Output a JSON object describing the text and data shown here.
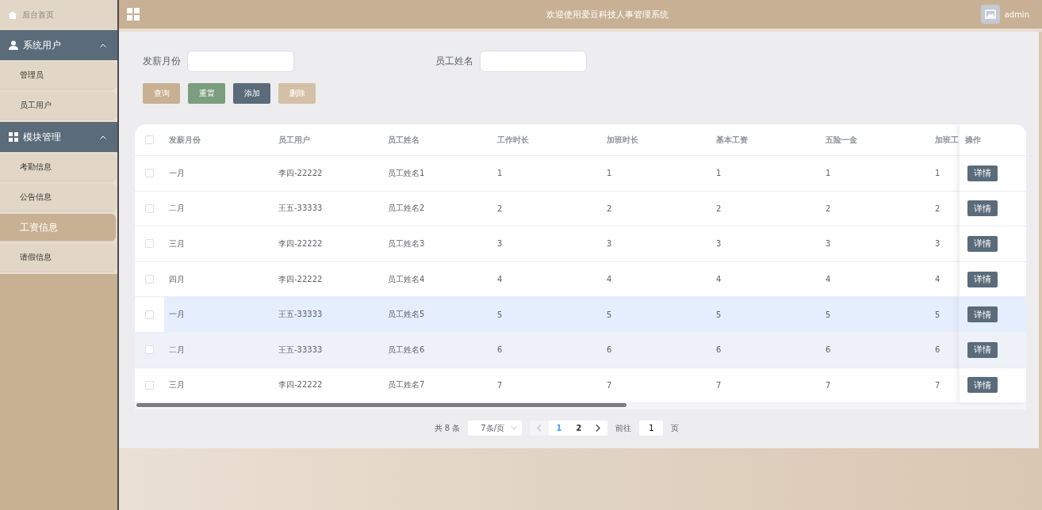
{
  "sidebar": {
    "home": {
      "label": "后台首页"
    },
    "groups": [
      {
        "label": "系统用户",
        "expanded": true,
        "children": [
          {
            "label": "管理员",
            "selected": false
          },
          {
            "label": "员工用户",
            "selected": false
          }
        ]
      },
      {
        "label": "模块管理",
        "expanded": true,
        "children": [
          {
            "label": "考勤信息",
            "selected": false
          },
          {
            "label": "公告信息",
            "selected": false
          },
          {
            "label": "工资信息",
            "selected": true
          },
          {
            "label": "请假信息",
            "selected": false
          }
        ]
      }
    ]
  },
  "header": {
    "title": "欢迎使用爱豆科技人事管理系统",
    "user": "admin"
  },
  "filters": [
    {
      "label": "发薪月份"
    },
    {
      "label": "员工姓名"
    }
  ],
  "buttons": [
    {
      "label": "查询",
      "kind": "query"
    },
    {
      "label": "重置",
      "kind": "reset"
    },
    {
      "label": "添加",
      "kind": "add"
    },
    {
      "label": "删除",
      "kind": "delete"
    }
  ],
  "table": {
    "all_checked": false,
    "columns": [
      "发薪月份",
      "员工用户",
      "员工姓名",
      "工作时长",
      "加班时长",
      "基本工资",
      "五险一金",
      "加班工"
    ],
    "action_column": "操作",
    "rows": [
      {
        "cells": [
          "一月",
          "李四-22222",
          "员工姓名1",
          "1",
          "1",
          "1",
          "1",
          "1"
        ],
        "action": "详情",
        "checked": false,
        "hovered": false,
        "striped": false
      },
      {
        "cells": [
          "二月",
          "王五-33333",
          "员工姓名2",
          "2",
          "2",
          "2",
          "2",
          "2"
        ],
        "action": "详情",
        "checked": false,
        "hovered": false,
        "striped": false
      },
      {
        "cells": [
          "三月",
          "李四-22222",
          "员工姓名3",
          "3",
          "3",
          "3",
          "3",
          "3"
        ],
        "action": "详情",
        "checked": false,
        "hovered": false,
        "striped": false
      },
      {
        "cells": [
          "四月",
          "李四-22222",
          "员工姓名4",
          "4",
          "4",
          "4",
          "4",
          "4"
        ],
        "action": "详情",
        "checked": false,
        "hovered": false,
        "striped": false
      },
      {
        "cells": [
          "一月",
          "王五-33333",
          "员工姓名5",
          "5",
          "5",
          "5",
          "5",
          "5"
        ],
        "action": "详情",
        "checked": false,
        "hovered": true,
        "striped": false
      },
      {
        "cells": [
          "二月",
          "王五-33333",
          "员工姓名6",
          "6",
          "6",
          "6",
          "6",
          "6"
        ],
        "action": "详情",
        "checked": false,
        "hovered": false,
        "striped": true
      },
      {
        "cells": [
          "三月",
          "李四-22222",
          "员工姓名7",
          "7",
          "7",
          "7",
          "7",
          "7"
        ],
        "action": "详情",
        "checked": false,
        "hovered": false,
        "striped": false
      }
    ]
  },
  "pagination": {
    "total": "共 8 条",
    "page_size": "7条/页",
    "pages": [
      {
        "label": "1",
        "selected": true
      },
      {
        "label": "2",
        "selected": false
      }
    ],
    "prev_disabled": true,
    "goto_label": "前往",
    "goto_value": "1",
    "goto_suffix": "页"
  }
}
